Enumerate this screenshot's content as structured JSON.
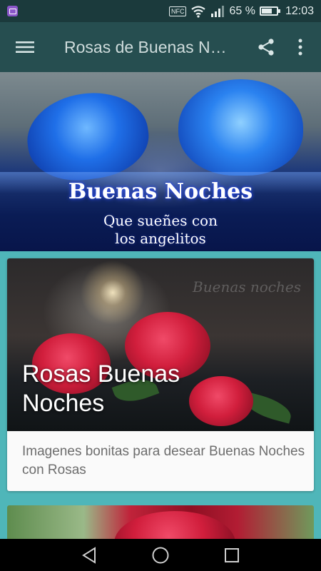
{
  "status_bar": {
    "nfc_label": "NFC",
    "battery_percent": "65 %",
    "battery_level": 0.65,
    "time": "12:03",
    "icons": [
      "gallery-icon",
      "nfc-icon",
      "wifi-icon",
      "signal-icon",
      "battery-icon"
    ]
  },
  "app_bar": {
    "title": "Rosas de Buenas Noches",
    "icons": [
      "menu-icon",
      "share-icon",
      "more-vert-icon"
    ]
  },
  "banner": {
    "title": "Buenas Noches",
    "subtitle_line1": "Que sueñes con",
    "subtitle_line2": "los angelitos"
  },
  "cards": [
    {
      "watermark": "Buenas noches",
      "headline_line1": "Rosas Buenas",
      "headline_line2": "Noches",
      "description": "Imagenes bonitas para desear Buenas Noches con Rosas"
    }
  ],
  "nav_bar": {
    "icons": [
      "back-icon",
      "home-icon",
      "recents-icon"
    ]
  },
  "colors": {
    "status_bar": "#1b3a3c",
    "app_bar": "#264e50",
    "background": "#4fb6b9",
    "card": "#fafafa"
  }
}
